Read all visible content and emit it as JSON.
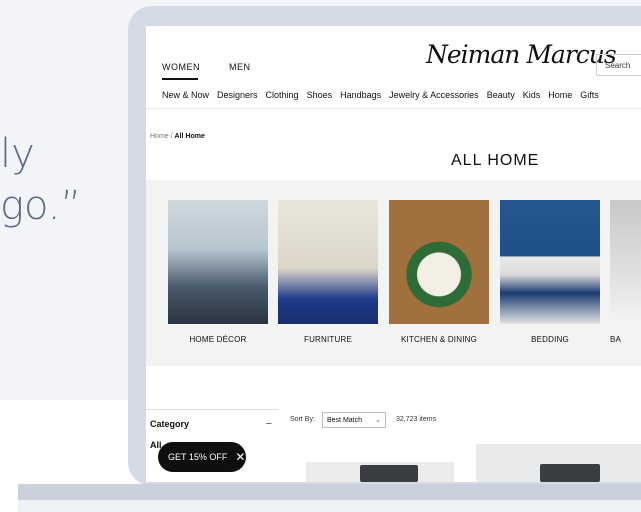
{
  "marketing": {
    "quote_line1": "ly",
    "quote_line2": "go.”"
  },
  "header": {
    "gender_tabs": [
      "WOMEN",
      "MEN"
    ],
    "logo_text": "Neiman Marcus",
    "search_placeholder": "Search",
    "nav": [
      "New & Now",
      "Designers",
      "Clothing",
      "Shoes",
      "Handbags",
      "Jewelry & Accessories",
      "Beauty",
      "Kids",
      "Home",
      "Gifts"
    ]
  },
  "breadcrumb": {
    "home": "Home",
    "sep": " / ",
    "current": "All Home"
  },
  "page_title": "ALL HOME",
  "categories": [
    "HOME DÉCOR",
    "FURNITURE",
    "KITCHEN & DINING",
    "BEDDING",
    "BA"
  ],
  "listing": {
    "sort_label": "Sort By:",
    "sort_value": "Best Match",
    "item_count": "32,723 items"
  },
  "filters": {
    "heading": "Category",
    "collapse_symbol": "–",
    "first_option": "All"
  },
  "promo": {
    "label": "GET 15% OFF",
    "close": "✕"
  }
}
